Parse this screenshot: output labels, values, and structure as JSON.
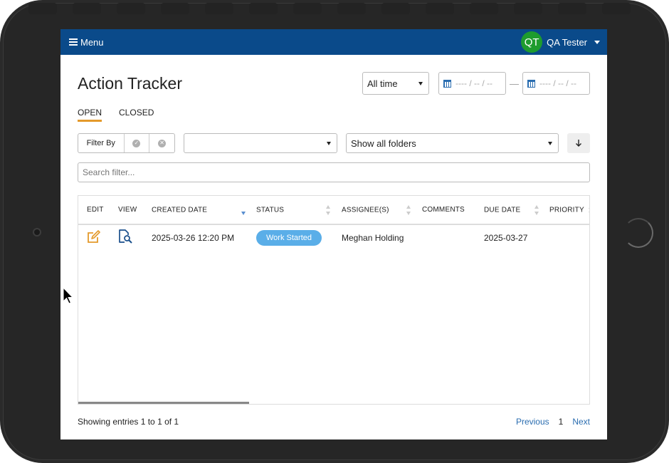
{
  "navbar": {
    "menu_label": "Menu",
    "user_initials": "QT",
    "user_name": "QA Tester"
  },
  "page": {
    "title": "Action Tracker"
  },
  "time_filter": {
    "selected": "All time"
  },
  "date_range": {
    "from_placeholder": "---- / -- / --",
    "separator": "—",
    "to_placeholder": "---- / -- / --"
  },
  "tabs": [
    {
      "label": "OPEN",
      "active": true
    },
    {
      "label": "CLOSED",
      "active": false
    }
  ],
  "filters": {
    "filter_by_label": "Filter By",
    "field_select_value": "",
    "folder_select_value": "Show all folders"
  },
  "search": {
    "placeholder": "Search filter..."
  },
  "table": {
    "columns": [
      "EDIT",
      "VIEW",
      "CREATED DATE",
      "STATUS",
      "ASSIGNEE(S)",
      "COMMENTS",
      "DUE DATE",
      "PRIORITY"
    ],
    "rows": [
      {
        "created_date": "2025-03-26 12:20 PM",
        "status": "Work Started",
        "assignees": "Meghan Holding",
        "comments": "",
        "due_date": "2025-03-27",
        "priority": ""
      }
    ]
  },
  "footer": {
    "entries_info": "Showing entries 1 to 1 of 1",
    "prev_label": "Previous",
    "page_number": "1",
    "next_label": "Next"
  },
  "colors": {
    "navbar": "#0a4a8a",
    "avatar": "#1e9c2e",
    "tab_underline": "#e49a2b",
    "status_badge": "#5aaee8",
    "edit_icon": "#e49a2b",
    "view_icon": "#1a4f8c",
    "link": "#2a6db0"
  },
  "icons": {
    "menu": "hamburger-icon",
    "user_caret": "chevron-down-icon",
    "calendar": "calendar-icon",
    "sort_down": "arrow-down-icon",
    "edit": "edit-icon",
    "view": "document-search-icon"
  }
}
